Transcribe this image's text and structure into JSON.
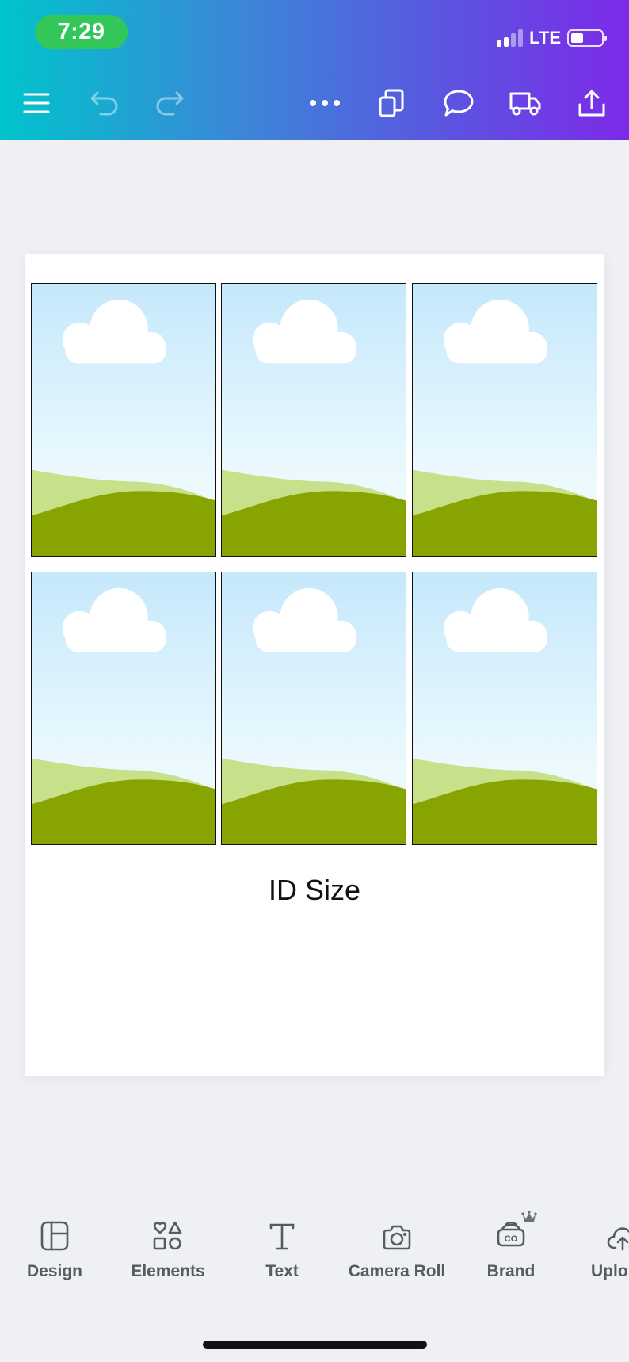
{
  "status_bar": {
    "time": "7:29",
    "network": "LTE"
  },
  "toolbar": {
    "icons": [
      "menu-icon",
      "undo-icon",
      "redo-icon",
      "more-icon",
      "pages-icon",
      "comment-icon",
      "print-delivery-icon",
      "share-icon"
    ]
  },
  "canvas": {
    "photo_count": 6,
    "caption": "ID Size"
  },
  "tabs": [
    {
      "label": "Design",
      "icon": "design-layout-icon"
    },
    {
      "label": "Elements",
      "icon": "elements-shapes-icon"
    },
    {
      "label": "Text",
      "icon": "text-icon"
    },
    {
      "label": "Camera Roll",
      "icon": "camera-icon"
    },
    {
      "label": "Brand",
      "icon": "brand-icon"
    },
    {
      "label": "Uplo",
      "icon": "upload-cloud-icon"
    }
  ],
  "colors": {
    "gradient_start": "#00c4cc",
    "gradient_end": "#7d2ae8",
    "time_pill": "#33c759",
    "hill_dark": "#88a400",
    "hill_light": "#c7e08a"
  }
}
